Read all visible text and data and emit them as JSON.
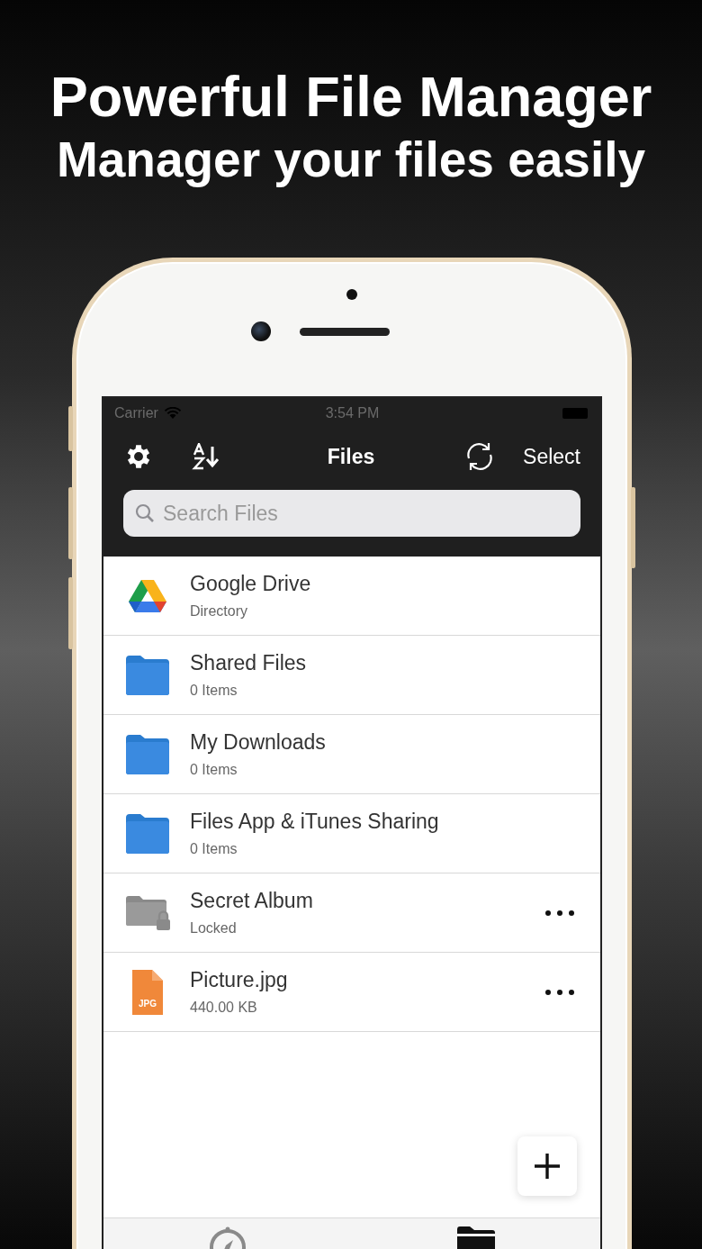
{
  "headline": [
    "Powerful File Manager",
    "Manager your files easily"
  ],
  "status_bar": {
    "carrier": "Carrier",
    "time": "3:54 PM"
  },
  "nav": {
    "title": "Files",
    "action": "Select"
  },
  "search": {
    "placeholder": "Search Files"
  },
  "items": [
    {
      "kind": "drive",
      "name": "Google Drive",
      "detail": "Directory",
      "menu": false
    },
    {
      "kind": "folder",
      "name": "Shared Files",
      "detail": "0 Items",
      "menu": false
    },
    {
      "kind": "folder",
      "name": "My Downloads",
      "detail": "0 Items",
      "menu": false
    },
    {
      "kind": "folder",
      "name": "Files App & iTunes Sharing",
      "detail": "0 Items",
      "menu": false
    },
    {
      "kind": "locked",
      "name": "Secret Album",
      "detail": "Locked",
      "menu": true
    },
    {
      "kind": "jpg",
      "name": "Picture.jpg",
      "detail": "440.00 KB",
      "menu": true,
      "badge": "JPG"
    }
  ],
  "tabs": [
    {
      "kind": "compass",
      "selected": false
    },
    {
      "kind": "folder",
      "selected": true
    }
  ]
}
